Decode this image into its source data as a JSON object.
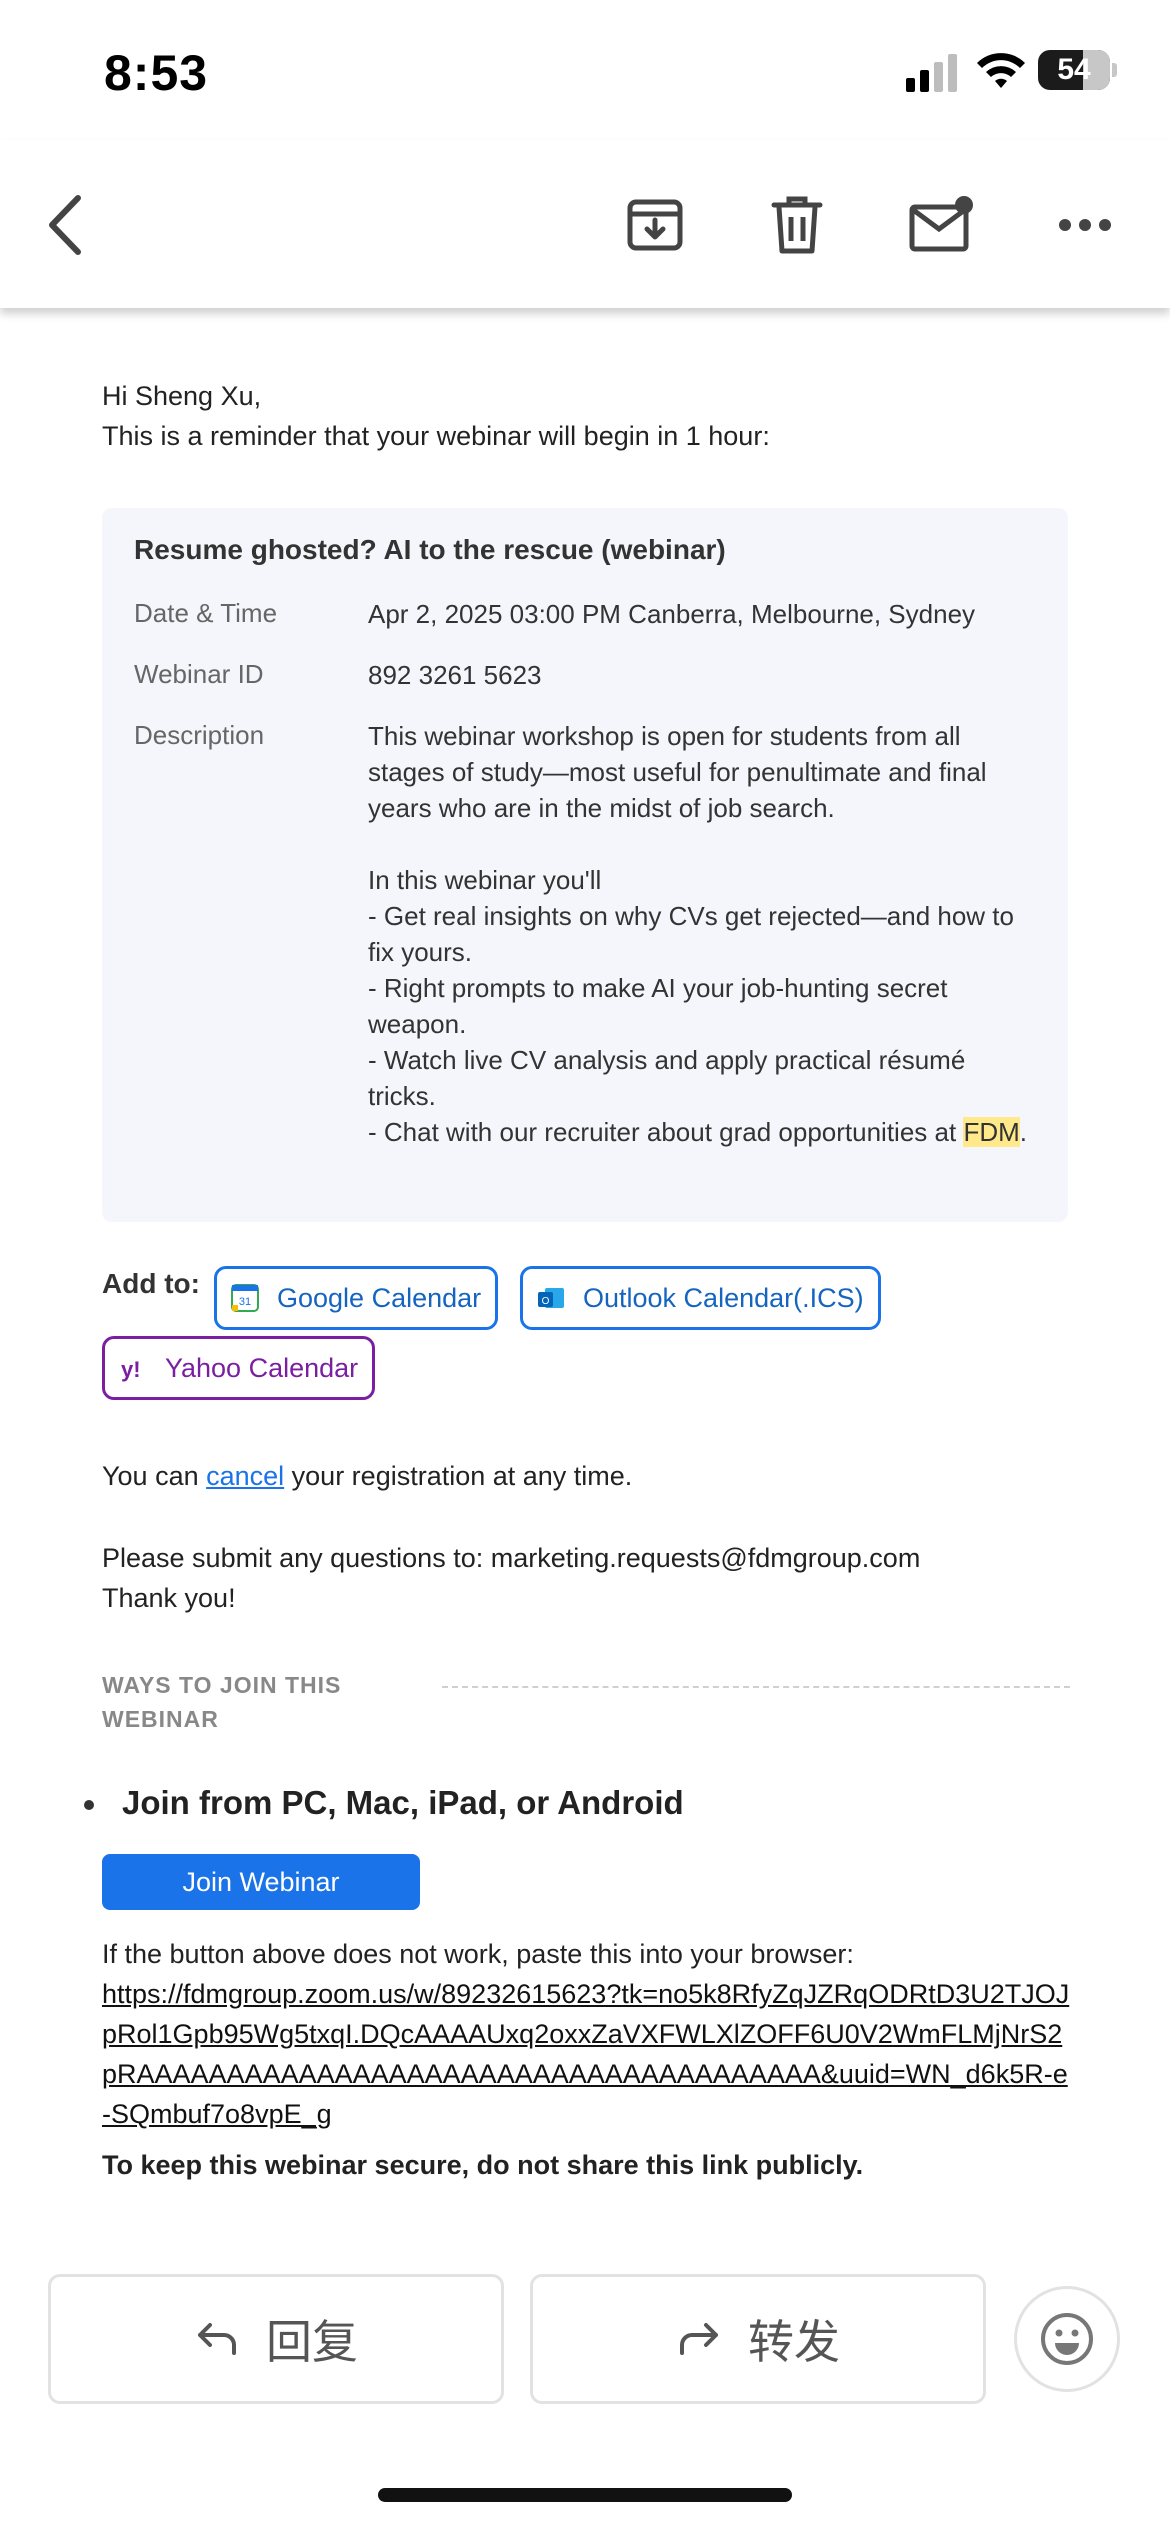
{
  "status_bar": {
    "time": "8:53",
    "battery": "54"
  },
  "toolbar": {
    "icons": [
      "back-icon",
      "archive-icon",
      "trash-icon",
      "mark-unread-icon",
      "more-icon"
    ]
  },
  "email": {
    "greeting": "Hi Sheng Xu,",
    "intro": "This is a reminder that your webinar will begin in 1 hour:",
    "card": {
      "title": "Resume ghosted? AI to the rescue (webinar)",
      "date_label": "Date & Time",
      "date_value": "Apr 2, 2025 03:00 PM Canberra, Melbourne, Sydney",
      "id_label": "Webinar ID",
      "id_value": "892 3261 5623",
      "desc_label": "Description",
      "desc_p1": "This webinar workshop is open for students from all stages of study—most useful for penultimate and final years who are in the midst of job search.",
      "desc_intro": "In this webinar you'll",
      "desc_b1": "- Get real insights on why CVs get rejected—and how to fix yours.",
      "desc_b2": "- Right prompts to make AI your job-hunting secret weapon.",
      "desc_b3": "- Watch live CV analysis and apply practical résumé tricks.",
      "desc_b4_pre": "- Chat with our recruiter about grad opportunities at ",
      "desc_b4_hl": "FDM",
      "desc_b4_post": "."
    },
    "add_to": {
      "label": "Add to:",
      "google": "Google Calendar",
      "outlook": "Outlook Calendar(.ICS)",
      "yahoo": "Yahoo Calendar"
    },
    "cancel_pre": "You can ",
    "cancel_link": "cancel",
    "cancel_post": " your registration at any time.",
    "questions": "Please submit any questions to: marketing.requests@fdmgroup.com",
    "thanks": "Thank you!",
    "ways_heading_1": "WAYS TO JOIN THIS",
    "ways_heading_2": "WEBINAR",
    "join_from": "Join from PC, Mac, iPad, or Android",
    "join_button": "Join Webinar",
    "fallback_text": "If the button above does not work, paste this into your browser:",
    "join_url": "https://fdmgroup.zoom.us/w/89232615623?tk=no5k8RfyZqJZRqODRtD3U2TJOJpRol1Gpb95Wg5txqI.DQcAAAAUxq2oxxZaVXFWLXlZOFF6U0V2WmFLMjNrS2pRAAAAAAAAAAAAAAAAAAAAAAAAAAAAAAAAAAAAAA&uuid=WN_d6k5R-e-SQmbuf7o8vpE_g",
    "secure_note": "To keep this webinar secure, do not share this link publicly."
  },
  "actions": {
    "reply": "回复",
    "forward": "转发"
  },
  "colors": {
    "accent": "#1a73e8",
    "yahoo": "#7b1fa2",
    "highlight": "#ffe98a"
  }
}
